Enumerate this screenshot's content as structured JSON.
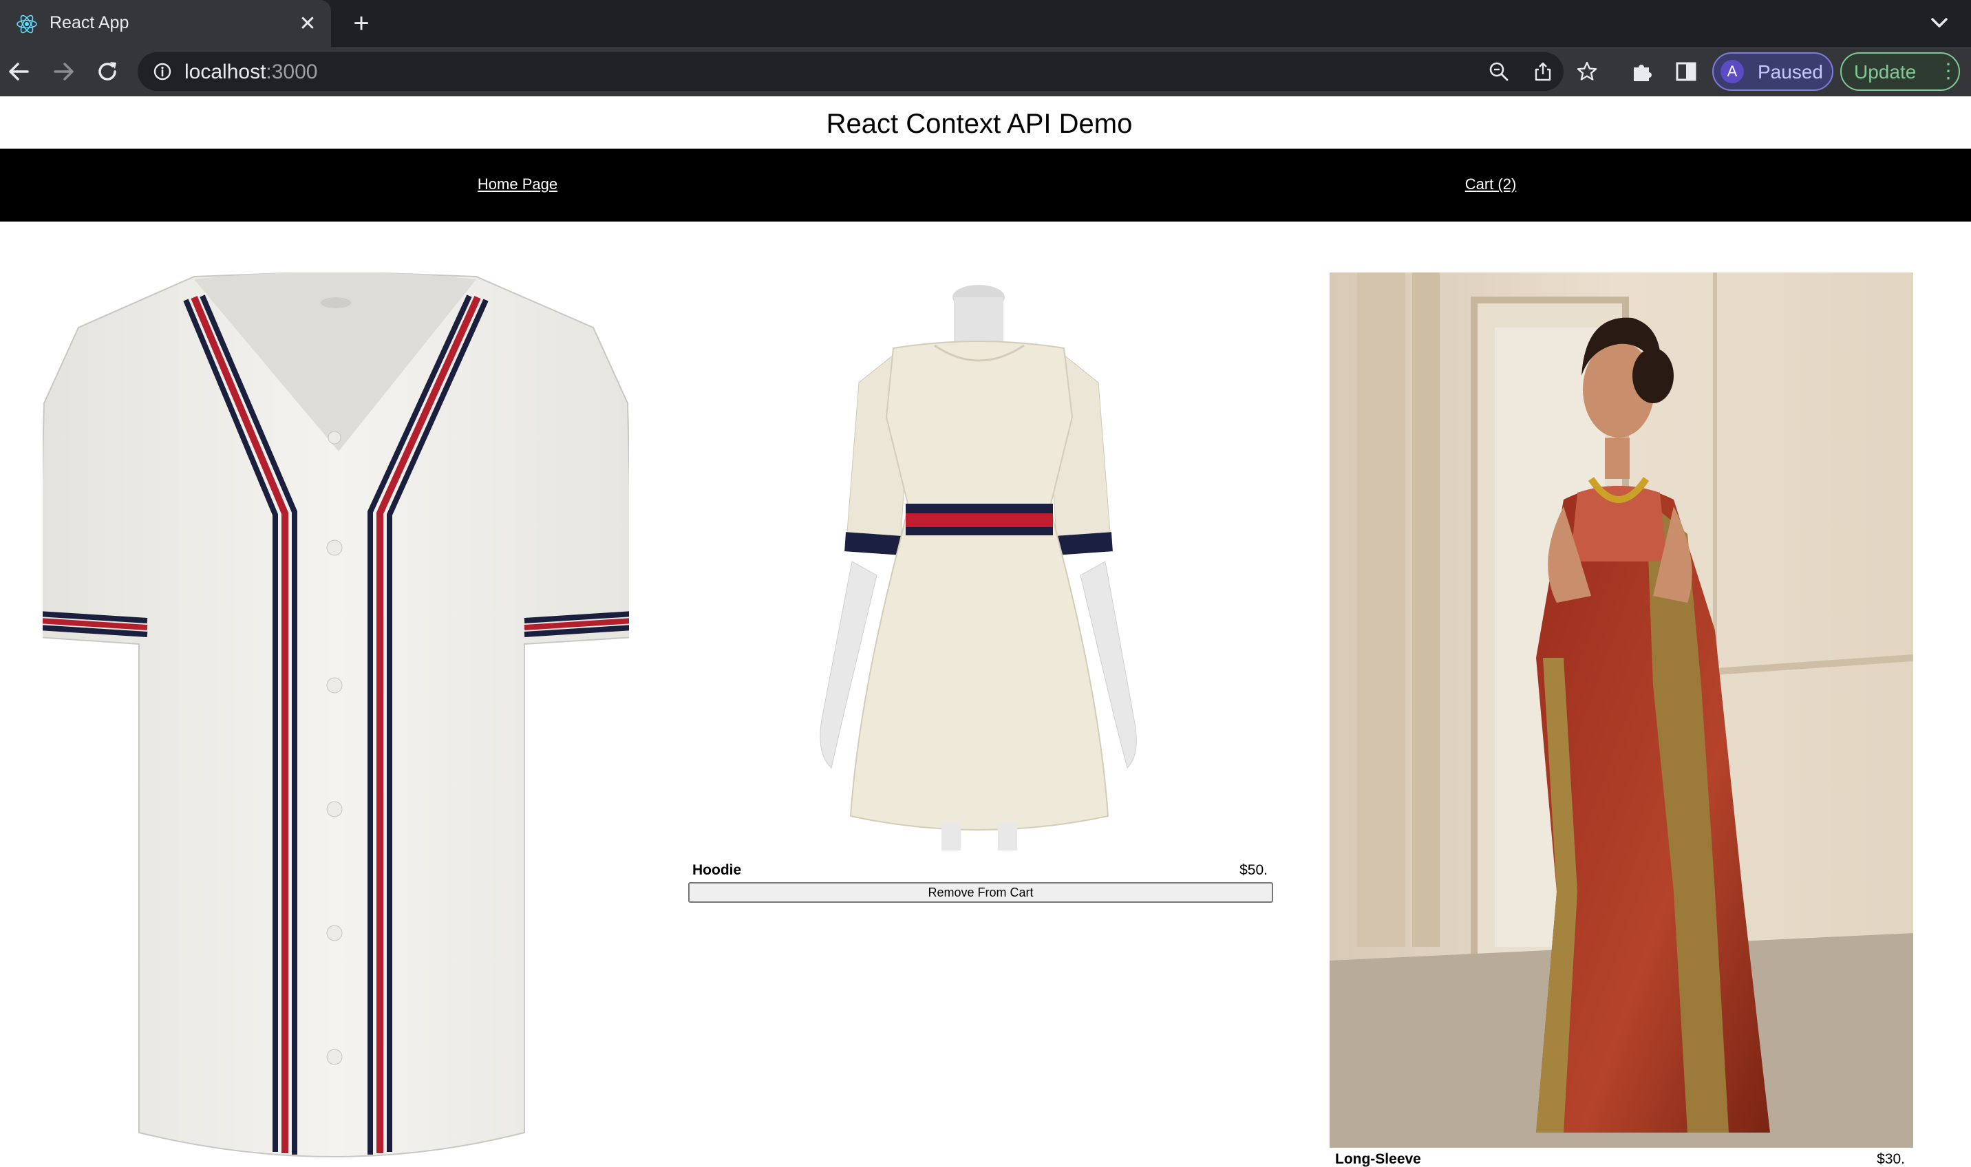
{
  "browser": {
    "tab_title": "React App",
    "tab_close": "✕",
    "new_tab": "+",
    "url_host": "localhost",
    "url_port": ":3000",
    "profile_initial": "A",
    "profile_status": "Paused",
    "update_label": "Update",
    "menu_glyph": "⋮"
  },
  "page": {
    "title": "React Context API Demo"
  },
  "navbar": {
    "home_label": "Home Page",
    "cart_label": "Cart (2)"
  },
  "products": [
    {
      "name": "Hoodie",
      "price": "$50.",
      "action": "Remove From Cart",
      "image": "white-dress-on-mannequin"
    },
    {
      "name": "Long-Sleeve",
      "price": "$30.",
      "image": "woman-in-red-saree"
    },
    {
      "image": "white-baseball-jersey"
    }
  ],
  "colors": {
    "chrome_dark": "#1f2023",
    "chrome_toolbar": "#35363a",
    "navbar": "#000000",
    "update_green": "#81c995",
    "profile_purple": "#3c3d6f"
  }
}
